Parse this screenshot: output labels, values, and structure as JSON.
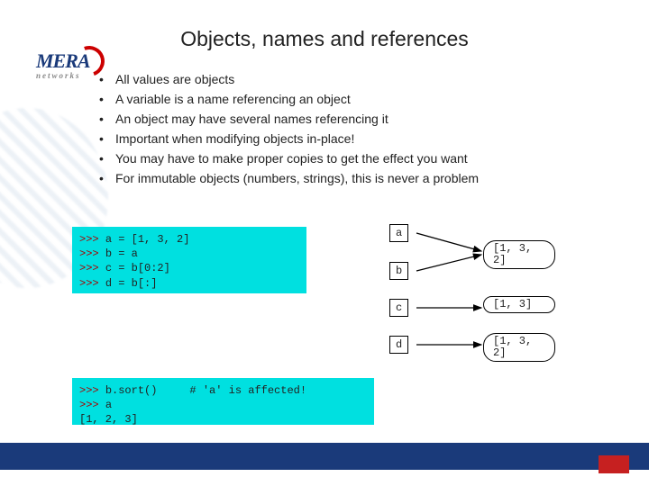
{
  "brand": {
    "name": "MERA",
    "sub": "networks"
  },
  "title": "Objects, names and references",
  "bullets": [
    "All values are objects",
    "A variable is a name referencing an object",
    "An object may have several names referencing it",
    "Important when modifying objects in-place!",
    "You may have to make proper copies to get the effect you want",
    "For immutable objects (numbers, strings), this is never a problem"
  ],
  "code1": {
    "l1_prompt": ">>> ",
    "l1_code": "a = [1, 3, 2]",
    "l2_prompt": ">>> ",
    "l2_code": "b = a",
    "l3_prompt": ">>> ",
    "l3_code": "c = b[0:2]",
    "l4_prompt": ">>> ",
    "l4_code": "d = b[:]"
  },
  "code2": {
    "l1_prompt": ">>> ",
    "l1_code": "b.sort()     # 'a' is affected!",
    "l2_prompt": ">>> ",
    "l2_code": "a",
    "l3_out": "[1, 2, 3]"
  },
  "diagram": {
    "a": "a",
    "b": "b",
    "c": "c",
    "d": "d",
    "obj1": "[1, 3, 2]",
    "obj2": "[1, 3]",
    "obj3": "[1, 3, 2]"
  }
}
